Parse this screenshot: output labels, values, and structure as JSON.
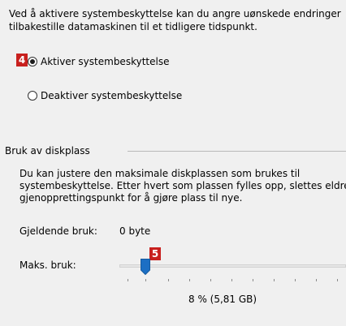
{
  "intro": {
    "line1": "Ved å aktivere systembeskyttelse kan du angre uønskede endringer",
    "line2": "tilbakestille datamaskinen til et tidligere tidspunkt."
  },
  "badges": {
    "step4": "4",
    "step5": "5"
  },
  "protection": {
    "enable_label": "Aktiver systembeskyttelse",
    "disable_label": "Deaktiver systembeskyttelse",
    "selected": "enable"
  },
  "disk_usage": {
    "group_title": "Bruk av diskplass",
    "desc_line1": "Du kan justere den maksimale diskplassen som brukes til",
    "desc_line2": "systembeskyttelse. Etter hvert som plassen fylles opp, slettes eldre",
    "desc_line3": "gjenopprettingspunkt for å gjøre plass til nye.",
    "current_label": "Gjeldende bruk:",
    "current_value": "0 byte",
    "max_label": "Maks. bruk:",
    "max_percent": 8,
    "max_value_text": "8 % (5,81 GB)"
  },
  "colors": {
    "badge": "#c8201e",
    "slider_thumb": "#1c6fc4"
  }
}
